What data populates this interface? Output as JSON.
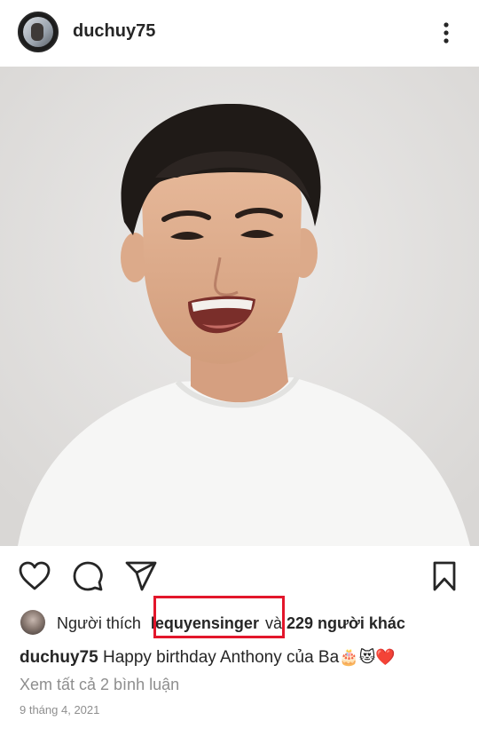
{
  "header": {
    "username": "duchuy75",
    "more_icon": "more-vertical-icon"
  },
  "post": {
    "photo_description_icon": "portrait-photo"
  },
  "actions": {
    "like_icon": "heart-icon",
    "comment_icon": "comment-icon",
    "share_icon": "send-icon",
    "save_icon": "bookmark-icon"
  },
  "likes": {
    "prefix": "Người thích",
    "liker": "lequyensinger",
    "connector": "và",
    "others": "229 người khác"
  },
  "caption": {
    "username": "duchuy75",
    "text": "Happy birthday Anthony  của Ba",
    "emojis": "🎂😻❤️"
  },
  "comments": {
    "view_all": "Xem tất cả 2 bình luận"
  },
  "date": "9 tháng 4, 2021",
  "colors": {
    "highlight": "#e3162b",
    "muted": "#8e8e8e",
    "text": "#262626"
  }
}
